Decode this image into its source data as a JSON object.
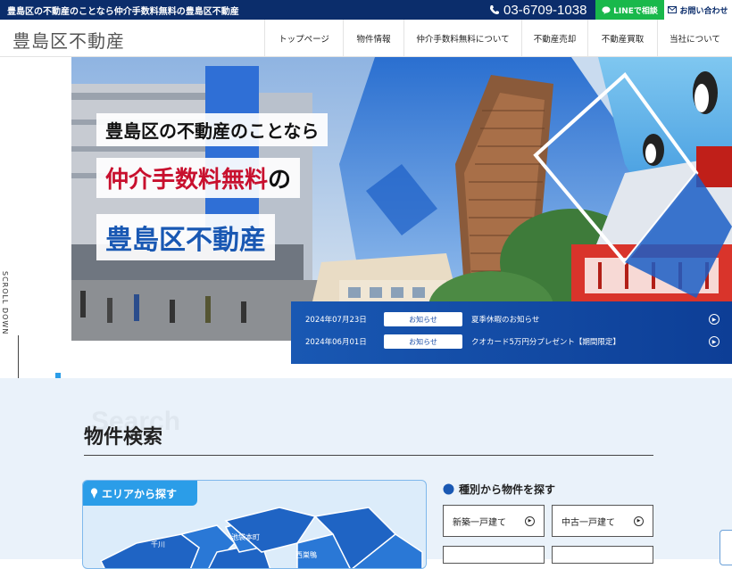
{
  "topbar": {
    "tagline": "豊島区の不動産のことなら仲介手数料無料の豊島区不動産",
    "phone": "03-6709-1038",
    "line_label": "LINEで相談",
    "contact_label": "お問い合わせ"
  },
  "header": {
    "logo": "豊島区不動産",
    "nav": [
      "トップページ",
      "物件情報",
      "仲介手数料無料について",
      "不動産売却",
      "不動産買取",
      "当社について"
    ]
  },
  "side": {
    "scroll_label": "SCROLL DOWN"
  },
  "hero": {
    "line1": "豊島区の不動産のことなら",
    "line2_red": "仲介手数料無料",
    "line2_suffix": "の",
    "line3": "豊島区不動産"
  },
  "news": [
    {
      "date": "2024年07月23日",
      "badge": "お知らせ",
      "title": "夏季休暇のお知らせ"
    },
    {
      "date": "2024年06月01日",
      "badge": "お知らせ",
      "title": "クオカード5万円分プレゼント【期間限定】"
    }
  ],
  "search": {
    "bg_word": "Search",
    "title": "物件検索",
    "area_tab": "エリアから探す",
    "type_heading": "種別から物件を探す",
    "types": [
      "新築一戸建て",
      "中古一戸建て"
    ],
    "map_labels": [
      "千川",
      "池袋本町",
      "西巣鴨"
    ]
  },
  "colors": {
    "navy": "#0b2d6b",
    "line_green": "#19b84b",
    "accent_blue": "#1958b3",
    "accent_red": "#c8102e"
  }
}
